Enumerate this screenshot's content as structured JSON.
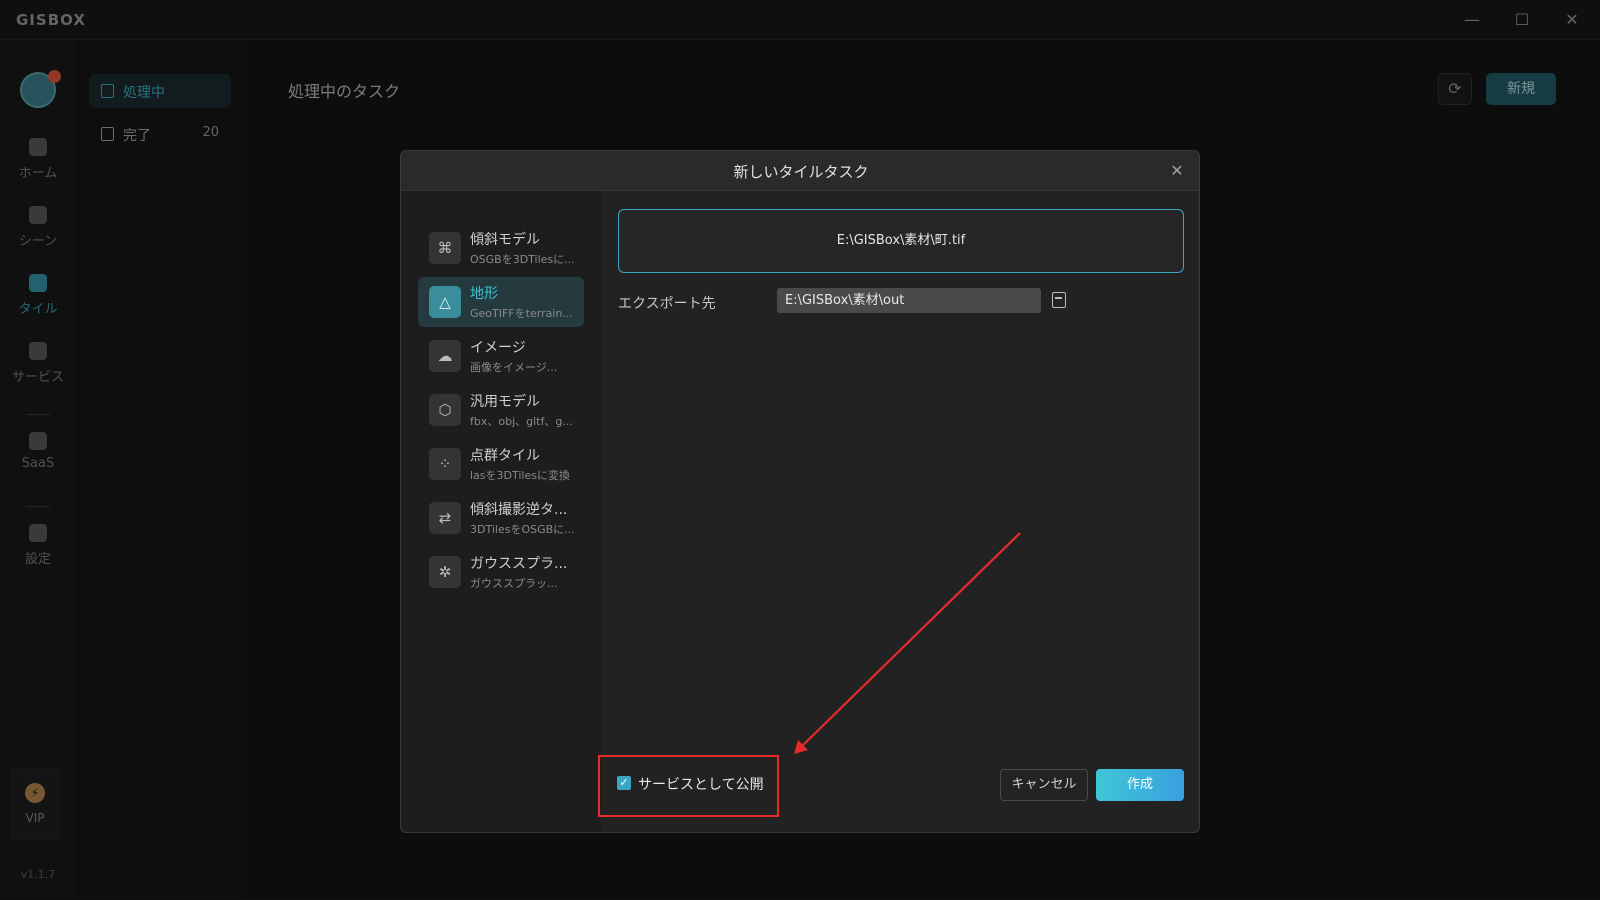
{
  "app": {
    "logo": "GISBOX"
  },
  "window_controls": {
    "minimize": "—",
    "maximize": "☐",
    "close": "✕"
  },
  "rail": {
    "items": [
      {
        "label": "ホーム",
        "icon": "home-icon"
      },
      {
        "label": "シーン",
        "icon": "scene-icon"
      },
      {
        "label": "タイル",
        "icon": "tile-icon",
        "active": true
      },
      {
        "label": "サービス",
        "icon": "service-icon"
      },
      {
        "label": "SaaS",
        "icon": "lock-icon"
      },
      {
        "label": "設定",
        "icon": "settings-icon"
      }
    ],
    "vip": {
      "icon": "⚡",
      "label": "VIP"
    },
    "version": "v1.1.7"
  },
  "subnav": {
    "processing": {
      "label": "処理中"
    },
    "done": {
      "label": "完了",
      "count": "20"
    }
  },
  "main": {
    "title": "処理中のタスク",
    "refresh_icon": "⟳",
    "new_button": "新規"
  },
  "dialog": {
    "title": "新しいタイルタスク",
    "close": "✕",
    "types": [
      {
        "name": "傾斜モデル",
        "desc": "OSGBを3DTilesに...",
        "icon": "⌘"
      },
      {
        "name": "地形",
        "desc": "GeoTIFFをterrain...",
        "icon": "△",
        "active": true
      },
      {
        "name": "イメージ",
        "desc": "画像をイメージ...",
        "icon": "☁"
      },
      {
        "name": "汎用モデル",
        "desc": "fbx、obj、gltf、g...",
        "icon": "⬡"
      },
      {
        "name": "点群タイル",
        "desc": "lasを3DTilesに変換",
        "icon": "⁘"
      },
      {
        "name": "傾斜撮影逆タ...",
        "desc": "3DTilesをOSGBに...",
        "icon": "⇄"
      },
      {
        "name": "ガウススプラ...",
        "desc": "ガウススプラッ...",
        "icon": "✲"
      }
    ],
    "file_path": "E:\\GISBox\\素材\\町.tif",
    "export_label": "エクスポート先",
    "export_value": "E:\\GISBox\\素材\\out",
    "publish_label": "サービスとして公開",
    "publish_checked": true,
    "cancel": "キャンセル",
    "create": "作成"
  },
  "annotation_color": "#e52b2b"
}
